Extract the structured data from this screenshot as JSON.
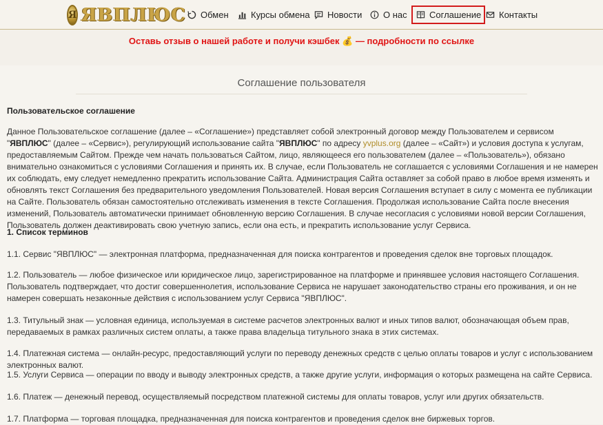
{
  "brand": {
    "mark": "Я",
    "name": "ЯВПЛЮС"
  },
  "nav": [
    {
      "label": "Обмен",
      "icon": "refresh-icon"
    },
    {
      "label": "Курсы обмена",
      "icon": "bar-chart-icon"
    },
    {
      "label": "Новости",
      "icon": "message-icon"
    },
    {
      "label": "О нас",
      "icon": "info-icon"
    },
    {
      "label": "Соглашение",
      "icon": "book-icon",
      "active": true
    },
    {
      "label": "Контакты",
      "icon": "mail-icon"
    }
  ],
  "promo": "Оставь отзыв о нашей работе и получи кэшбек 💰 — подробности по ссылке",
  "page_title": "Соглашение пользователя",
  "sections": {
    "heading": "Пользовательское соглашение",
    "intro_a": "Данное Пользовательское соглашение (далее – «Соглашение») представляет собой электронный договор между Пользователем и сервисом \"",
    "intro_brand": "ЯВПЛЮС",
    "intro_b": "\" (далее – «Сервис»), регулирующий использование сайта \"",
    "intro_brand2": "ЯВПЛЮС",
    "intro_c": "\" по адресу ",
    "intro_link": "yvplus.org",
    "intro_d": " (далее – «Сайт») и условия доступа к услугам, предоставляемым Сайтом. Прежде чем начать пользоваться Сайтом, лицо, являющееся его пользователем (далее – «Пользователь»), обязано внимательно ознакомиться с условиями Соглашения и принять их. В случае, если Пользователь не соглашается с условиями Соглашения и не намерен их соблюдать, ему следует немедленно прекратить использование Сайта. Администрация Сайта оставляет за собой право в любое время изменять и обновлять текст Соглашения без предварительного уведомления Пользователей. Новая версия Соглашения вступает в силу с момента ее публикации на Сайте. Пользователь обязан самостоятельно отслеживать изменения в тексте Соглашения. Продолжая использование Сайта после внесения изменений, Пользователь автоматически принимает обновленную версию Соглашения. В случае несогласия с условиями новой версии Соглашения, Пользователь должен деактивировать свою учетную запись, если она есть, и прекратить использование услуг Сервиса.",
    "terms_heading": "1. Список терминов",
    "t1": "1.1. Сервис \"ЯВПЛЮС\" — электронная платформа, предназначенная для поиска контрагентов и проведения сделок вне торговых площадок.",
    "t2": "1.2. Пользователь — любое физическое или юридическое лицо, зарегистрированное на платформе и принявшее условия настоящего Соглашения. Пользователь подтверждает, что достиг совершеннолетия, использование Сервиса не нарушает законодательство страны его проживания, и он не намерен совершать незаконные действия с использованием услуг Сервиса \"ЯВПЛЮС\".",
    "t3": "1.3. Титульный знак — условная единица, используемая в системе расчетов электронных валют и иных типов валют, обозначающая объем прав, передаваемых в рамках различных систем оплаты, а также права владельца титульного знака в этих системах.",
    "t4": "1.4. Платежная система — онлайн-ресурс, предоставляющий услуги по переводу денежных средств с целью оплаты товаров и услуг с использованием электронных валют.",
    "t5": "1.5. Услуги Сервиса — операции по вводу и выводу электронных средств, а также другие услуги, информация о которых размещена на сайте Сервиса.",
    "t6": "1.6. Платеж — денежный перевод, осуществляемый посредством платежной системы для оплаты товаров, услуг или других обязательств.",
    "t7": "1.7. Платформа — торговая площадка, предназначенная для поиска контрагентов и проведения сделок вне биржевых торгов."
  }
}
